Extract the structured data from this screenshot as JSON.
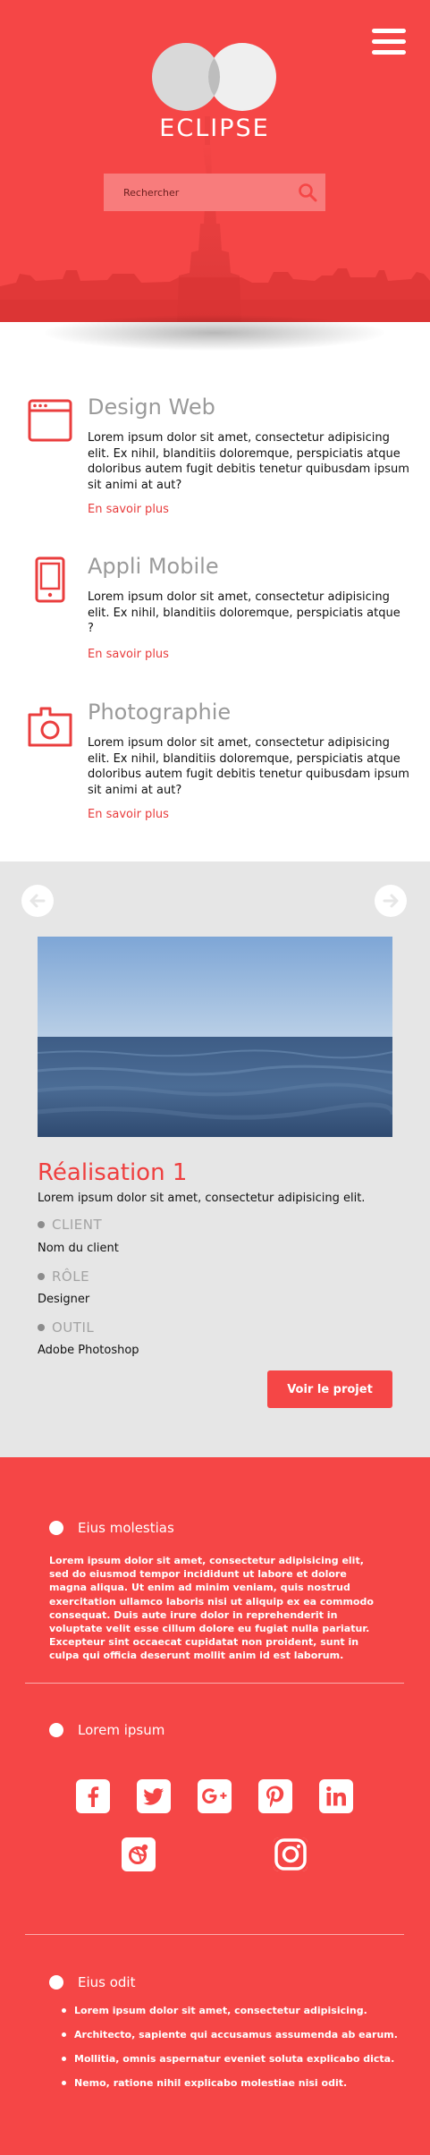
{
  "header": {
    "logo_text": "ECLIPSE",
    "menu_icon": "hamburger-menu-icon",
    "search": {
      "placeholder": "Rechercher",
      "value": "",
      "icon": "search-icon"
    },
    "colors": {
      "brand": "#f54646",
      "search_bg": "#f87c7c"
    }
  },
  "services": [
    {
      "icon": "browser-window-icon",
      "title": "Design Web",
      "text": "Lorem ipsum dolor sit amet, consectetur adipisicing elit. Ex nihil, blanditiis doloremque, perspiciatis atque doloribus autem fugit debitis tenetur quibusdam ipsum sit animi at aut?",
      "link": "En savoir plus"
    },
    {
      "icon": "mobile-phone-icon",
      "title": "Appli Mobile",
      "text": "Lorem ipsum dolor sit amet, consectetur adipisicing elit. Ex nihil, blanditiis doloremque, perspiciatis atque ?",
      "link": "En savoir plus"
    },
    {
      "icon": "camera-icon",
      "title": "Photographie",
      "text": "Lorem ipsum dolor sit amet, consectetur adipisicing elit. Ex nihil, blanditiis doloremque, perspiciatis atque doloribus autem fugit debitis tenetur quibusdam ipsum sit animi at aut?",
      "link": "En savoir plus"
    }
  ],
  "portfolio": {
    "prev_icon": "arrow-left-icon",
    "next_icon": "arrow-right-icon",
    "title": "Réalisation 1",
    "description": "Lorem ipsum dolor sit amet, consectetur adipisicing elit.",
    "client_label": "CLIENT",
    "client_value": "Nom du client",
    "role_label": "RÔLE",
    "role_value": "Designer",
    "tool_label": "OUTIL",
    "tool_value": "Adobe Photoshop",
    "button": "Voir le projet"
  },
  "footer": {
    "about": {
      "heading": "Eius molestias",
      "text": "Lorem ipsum dolor sit amet, consectetur adipisicing elit, sed do eiusmod tempor incididunt ut labore et dolore magna aliqua. Ut enim ad minim veniam, quis nostrud exercitation ullamco laboris nisi ut aliquip ex ea commodo consequat. Duis aute irure dolor in reprehenderit in voluptate velit esse cillum dolore eu fugiat nulla pariatur. Excepteur sint occaecat cupidatat non proident, sunt in culpa qui officia deserunt mollit anim id est laborum."
    },
    "social": {
      "heading": "Lorem ipsum",
      "icons": [
        "facebook-icon",
        "twitter-icon",
        "google-plus-icon",
        "pinterest-icon",
        "linkedin-icon",
        "dribbble-icon",
        "instagram-icon"
      ]
    },
    "links": {
      "heading": "Eius odit",
      "items": [
        "Lorem ipsum dolor sit amet, consectetur adipisicing.",
        "Architecto, sapiente qui accusamus assumenda ab earum.",
        "Mollitia, omnis aspernatur eveniet soluta explicabo dicta.",
        "Nemo, ratione nihil explicabo molestiae nisi odit."
      ]
    }
  }
}
